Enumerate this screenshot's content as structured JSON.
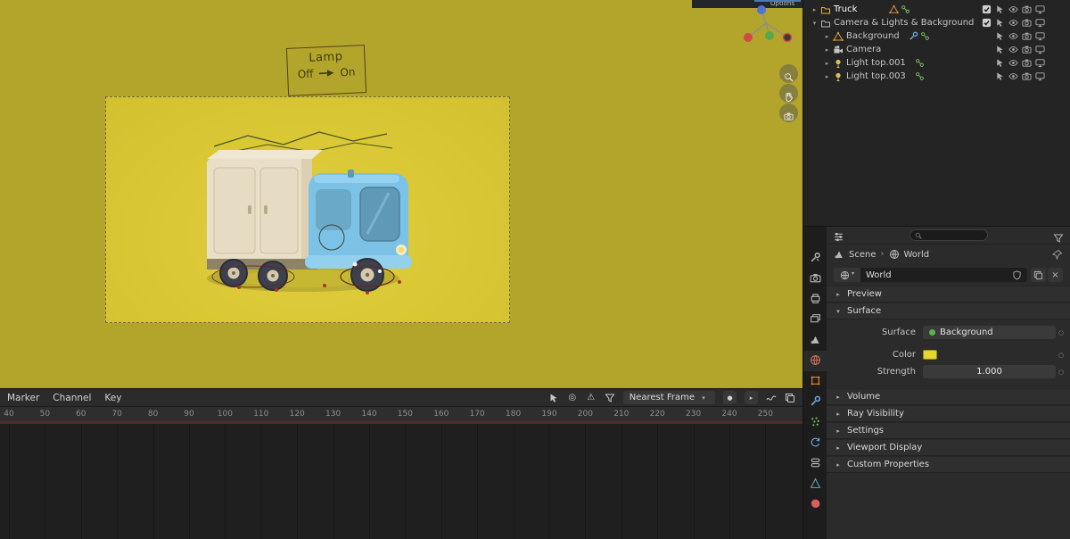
{
  "colors": {
    "viewport_outer": "#b3a42c",
    "viewport_inner": "#d9c734",
    "world_color": "#e3d82b",
    "surface_node_green": "#5bb353"
  },
  "viewport": {
    "header_label": "Options",
    "lamp": {
      "title": "Lamp",
      "off": "Off",
      "on": "On"
    }
  },
  "outliner": {
    "rows": [
      {
        "label": "Truck"
      },
      {
        "label": "Camera & Lights & Background"
      },
      {
        "label": "Background"
      },
      {
        "label": "Camera"
      },
      {
        "label": "Light top.001"
      },
      {
        "label": "Light top.003"
      }
    ]
  },
  "properties": {
    "breadcrumb": {
      "scene": "Scene",
      "world": "World"
    },
    "id_name": "World",
    "panels": {
      "preview": "Preview",
      "surface": "Surface",
      "volume": "Volume",
      "ray": "Ray Visibility",
      "settings": "Settings",
      "viewport_display": "Viewport Display",
      "custom": "Custom Properties"
    },
    "surface": {
      "surface_label": "Surface",
      "surface_value": "Background",
      "color_label": "Color",
      "strength_label": "Strength",
      "strength_value": "1.000"
    }
  },
  "timeline": {
    "menus": [
      "Marker",
      "Channel",
      "Key"
    ],
    "snap": "Nearest Frame",
    "ticks": [
      40,
      50,
      60,
      70,
      80,
      90,
      100,
      110,
      120,
      130,
      140,
      150,
      160,
      170,
      180,
      190,
      200,
      210,
      220,
      230,
      240,
      250
    ]
  }
}
